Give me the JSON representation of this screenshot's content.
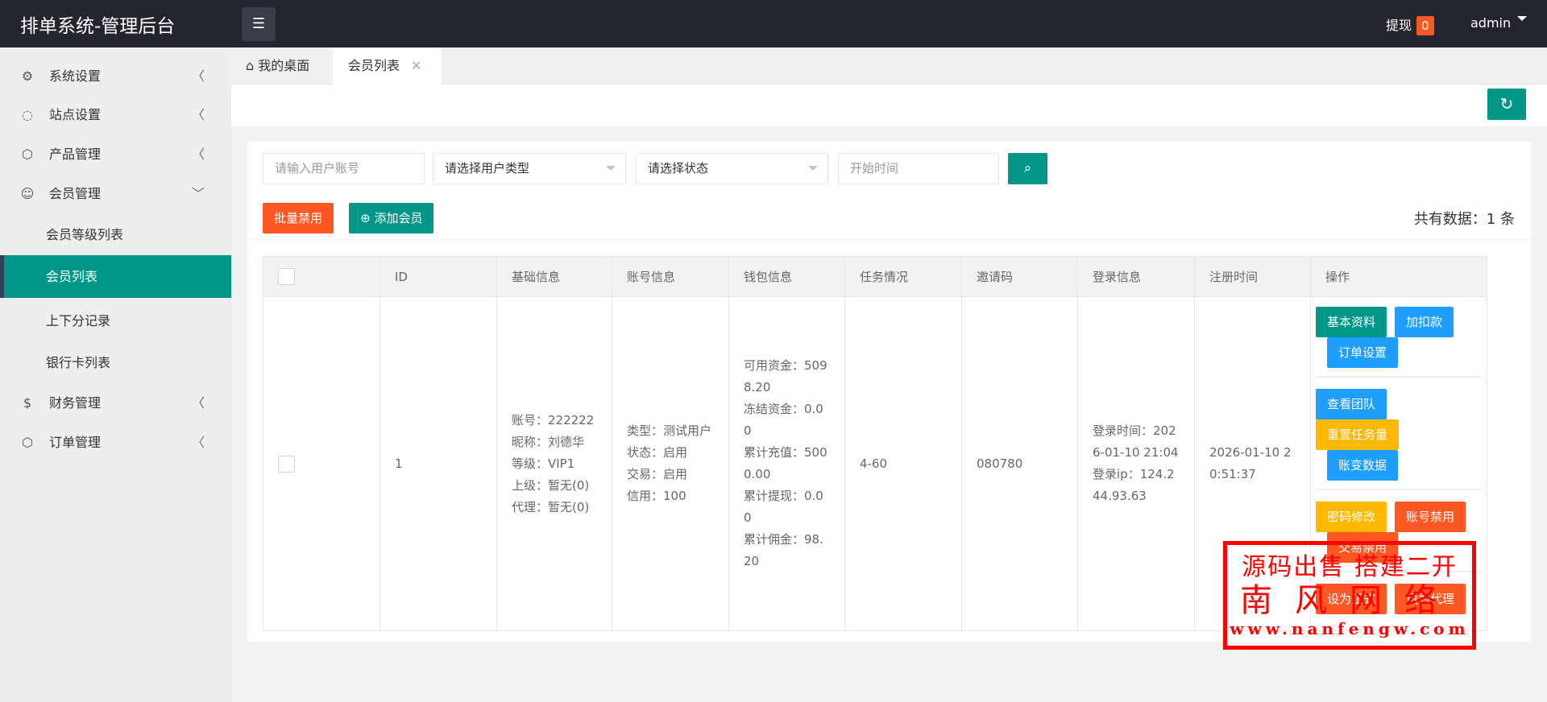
{
  "header": {
    "title": "排单系统-管理后台",
    "withdraw_label": "提现",
    "withdraw_count": "0",
    "user": "admin"
  },
  "sidebar": {
    "items": [
      {
        "label": "系统设置",
        "icon": "gear-icon"
      },
      {
        "label": "站点设置",
        "icon": "site-icon"
      },
      {
        "label": "产品管理",
        "icon": "box-icon"
      },
      {
        "label": "会员管理",
        "icon": "user-icon"
      },
      {
        "label": "财务管理",
        "icon": "dollar-icon"
      },
      {
        "label": "订单管理",
        "icon": "box-icon"
      }
    ],
    "sub_items": [
      {
        "label": "会员等级列表"
      },
      {
        "label": "会员列表"
      },
      {
        "label": "上下分记录"
      },
      {
        "label": "银行卡列表"
      }
    ]
  },
  "tabs": [
    {
      "label": "我的桌面"
    },
    {
      "label": "会员列表"
    }
  ],
  "filters": {
    "account_placeholder": "请输入用户账号",
    "user_type": "请选择用户类型",
    "status": "请选择状态",
    "start_placeholder": "开始时间"
  },
  "actions": {
    "batch_disable": "批量禁用",
    "add_member": "添加会员",
    "total": "共有数据：1 条"
  },
  "table": {
    "headers": [
      "ID",
      "基础信息",
      "账号信息",
      "钱包信息",
      "任务情况",
      "邀请码",
      "登录信息",
      "注册时间",
      "操作"
    ],
    "rows": [
      {
        "id": "1",
        "basic": [
          "账号：222222",
          "昵称：刘德华",
          "等级：VIP1",
          "上级：暂无(0)",
          "代理：暂无(0)"
        ],
        "account": [
          "类型：测试用户",
          "状态：启用",
          "交易：启用",
          "信用：100"
        ],
        "wallet": [
          "可用资金：5098.20",
          "冻结资金：0.00",
          "累计充值：5000.00",
          "累计提现：0.00",
          "累计佣金：98.20"
        ],
        "task": "4-60",
        "invite": "080780",
        "login": [
          "登录时间：2026-01-10 21:04",
          "登录ip：124.244.93.63"
        ],
        "register": "2026-01-10 20:51:37",
        "ops": [
          [
            "基本资料",
            "加扣款",
            "订单设置"
          ],
          [
            "查看团队",
            "重置任务量",
            "账变数据"
          ],
          [
            "密码修改",
            "账号禁用",
            "交易禁用"
          ],
          [
            "设为正式",
            "设为代理"
          ]
        ]
      }
    ]
  },
  "watermark": {
    "line1": "源码出售 搭建二开",
    "line2": "南风网络",
    "line3": "www.nanfengw.com"
  },
  "colors": {
    "primary": "#009688",
    "danger": "#ff5722",
    "info": "#1e9fff",
    "warn": "#ffb800",
    "header": "#23262e"
  }
}
